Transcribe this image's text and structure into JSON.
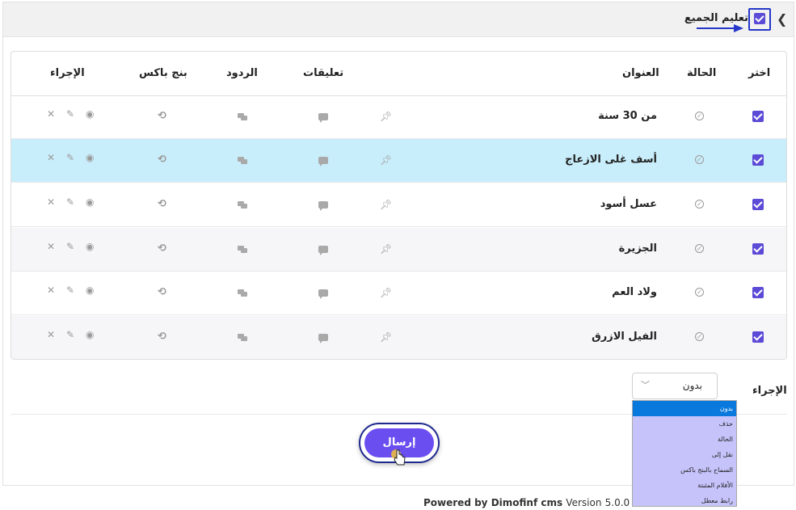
{
  "header": {
    "select_all_label": "تعليم الجميع",
    "select_all_checked": true
  },
  "table": {
    "columns": {
      "choose": "اختر",
      "status": "الحالة",
      "title": "العنوان",
      "comments": "تعليقات",
      "replies": "الردود",
      "inbox": "بنج باكس",
      "action": "الإجراء"
    },
    "rows": [
      {
        "title": "من 30 سنة",
        "checked": true
      },
      {
        "title": "أسف غلى الازعاج",
        "checked": true
      },
      {
        "title": "عسل أسود",
        "checked": true
      },
      {
        "title": "الجزيرة",
        "checked": true
      },
      {
        "title": "ولاد العم",
        "checked": true
      },
      {
        "title": "الفيل الازرق",
        "checked": true
      }
    ]
  },
  "actions": {
    "label": "الإجراء",
    "selected": "بدون",
    "options": [
      "بدون",
      "حذف",
      "الحالة",
      "نقل إلى",
      "السماح بالبنج باكس",
      "الأفلام المثبتة",
      "رابط معطل"
    ]
  },
  "submit_label": "إرسال",
  "footer": {
    "prefix": "Powered by",
    "brand": "Dimofinf cms",
    "version_label": "Version",
    "version": "5.0.0"
  },
  "icons": {
    "expand": "chevron-icon",
    "status": "check-circle-icon",
    "pin": "pin-icon",
    "comments": "comment-icon",
    "replies": "replies-icon",
    "inbox": "refresh-icon",
    "view": "eye-icon",
    "edit": "pencil-icon",
    "delete": "close-icon"
  },
  "colors": {
    "accent": "#5b4bd6",
    "highlight_row": "#c9eefb",
    "dropdown_bg": "#c6c3fb",
    "dropdown_selected": "#0a79dd",
    "submit": "#6a4ef0",
    "annotation": "#2437c8"
  }
}
